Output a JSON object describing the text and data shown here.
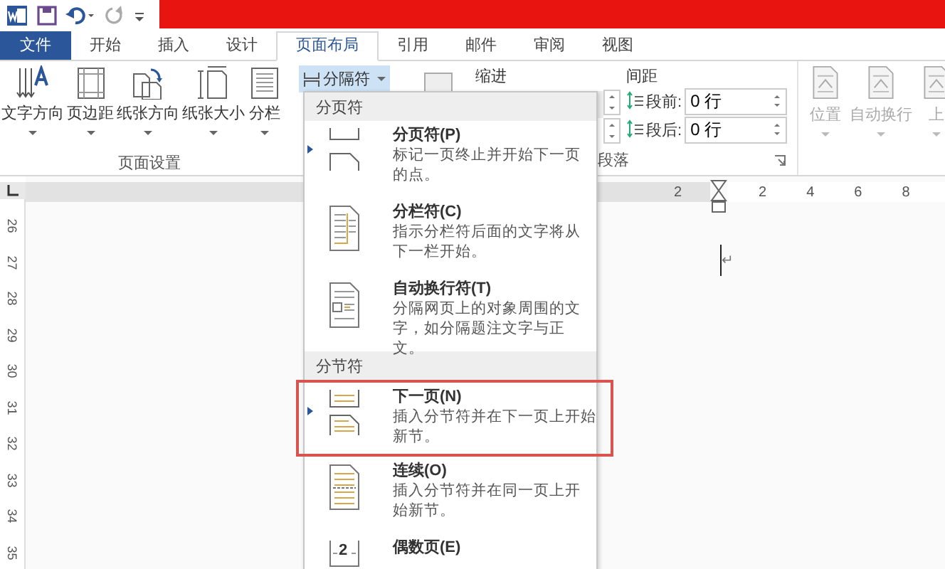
{
  "tabs": [
    {
      "label": "文件",
      "kind": "file",
      "selected": false
    },
    {
      "label": "开始",
      "kind": "tab",
      "selected": false
    },
    {
      "label": "插入",
      "kind": "tab",
      "selected": false
    },
    {
      "label": "设计",
      "kind": "tab",
      "selected": false
    },
    {
      "label": "页面布局",
      "kind": "tab",
      "selected": true
    },
    {
      "label": "引用",
      "kind": "tab",
      "selected": false
    },
    {
      "label": "邮件",
      "kind": "tab",
      "selected": false
    },
    {
      "label": "审阅",
      "kind": "tab",
      "selected": false
    },
    {
      "label": "视图",
      "kind": "tab",
      "selected": false
    }
  ],
  "page_setup": {
    "buttons": [
      {
        "label": "文字方向",
        "kind": "direction"
      },
      {
        "label": "页边距",
        "kind": "margins"
      },
      {
        "label": "纸张方向",
        "kind": "orientation"
      },
      {
        "label": "纸张大小",
        "kind": "size"
      },
      {
        "label": "分栏",
        "kind": "columns"
      }
    ],
    "breaks_button": "分隔符",
    "group_label": "页面设置"
  },
  "indent": {
    "label": "缩进"
  },
  "spacing": {
    "label": "间距",
    "before_label": "段前:",
    "before_value": "0 行",
    "after_label": "段后:",
    "after_value": "0 行"
  },
  "paragraph_group_label": "段落",
  "arrange": [
    {
      "label": "位置"
    },
    {
      "label": "自动换行"
    },
    {
      "label": "上"
    }
  ],
  "ruler": {
    "horizontal": [
      "2",
      "2",
      "4",
      "6",
      "8"
    ],
    "vertical": [
      "26",
      "27",
      "28",
      "29",
      "30",
      "31",
      "32",
      "33",
      "34",
      "35"
    ]
  },
  "document": {
    "paragraph_mark": "↵"
  },
  "breaks_menu": {
    "sections": [
      {
        "header": "分页符",
        "items": [
          {
            "title": "分页符(P)",
            "description": "标记一页终止并开始下一页的点。",
            "kind": "page",
            "marker": true,
            "highlighted": false
          },
          {
            "title": "分栏符(C)",
            "description": "指示分栏符后面的文字将从下一栏开始。",
            "kind": "column",
            "marker": false,
            "highlighted": false
          },
          {
            "title": "自动换行符(T)",
            "description": "分隔网页上的对象周围的文字，如分隔题注文字与正文。",
            "kind": "wrap",
            "marker": false,
            "highlighted": false
          }
        ]
      },
      {
        "header": "分节符",
        "items": [
          {
            "title": "下一页(N)",
            "description": "插入分节符并在下一页上开始新节。",
            "kind": "next",
            "marker": true,
            "highlighted": true
          },
          {
            "title": "连续(O)",
            "description": "插入分节符并在同一页上开始新节。",
            "kind": "continuous",
            "marker": false,
            "highlighted": false
          },
          {
            "title": "偶数页(E)",
            "kind": "even",
            "icon_text": "2",
            "marker": false,
            "highlighted": false
          }
        ]
      }
    ]
  }
}
